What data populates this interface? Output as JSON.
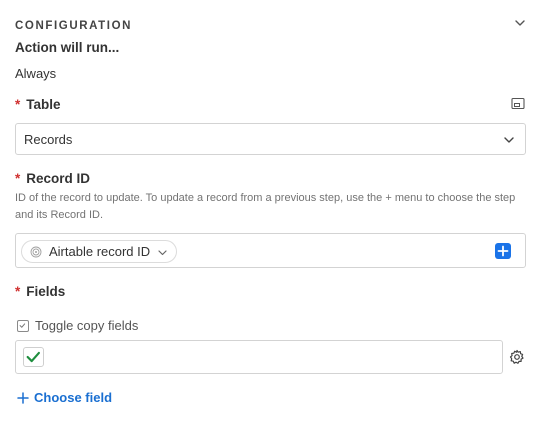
{
  "section": {
    "title": "CONFIGURATION",
    "collapse_icon": "chevron-down-icon"
  },
  "action": {
    "label": "Action will run...",
    "value": "Always"
  },
  "table_field": {
    "required_mark": "*",
    "label": "Table",
    "layout_icon": "panel-layout-icon",
    "selected": "Records",
    "chevron_icon": "chevron-down-icon"
  },
  "record_id_field": {
    "required_mark": "*",
    "label": "Record ID",
    "help": "ID of the record to update. To update a record from a previous step, use the + menu to choose the step and its Record ID.",
    "token": {
      "label": "Airtable record ID",
      "icon": "fingerprint-icon",
      "chevron_icon": "chevron-down-icon"
    },
    "add_icon": "plus-square-icon"
  },
  "fields_field": {
    "required_mark": "*",
    "label": "Fields",
    "toggle": {
      "label": "Toggle copy fields",
      "icon": "checkbox-icon"
    },
    "checkbox_checked": true,
    "settings_icon": "gear-icon"
  },
  "choose_field": {
    "label": "Choose field",
    "icon": "plus-icon"
  },
  "colors": {
    "required": "#d0302f",
    "link": "#1a6fd1",
    "primary_button": "#1a73e8",
    "check": "#1e8e3e"
  }
}
